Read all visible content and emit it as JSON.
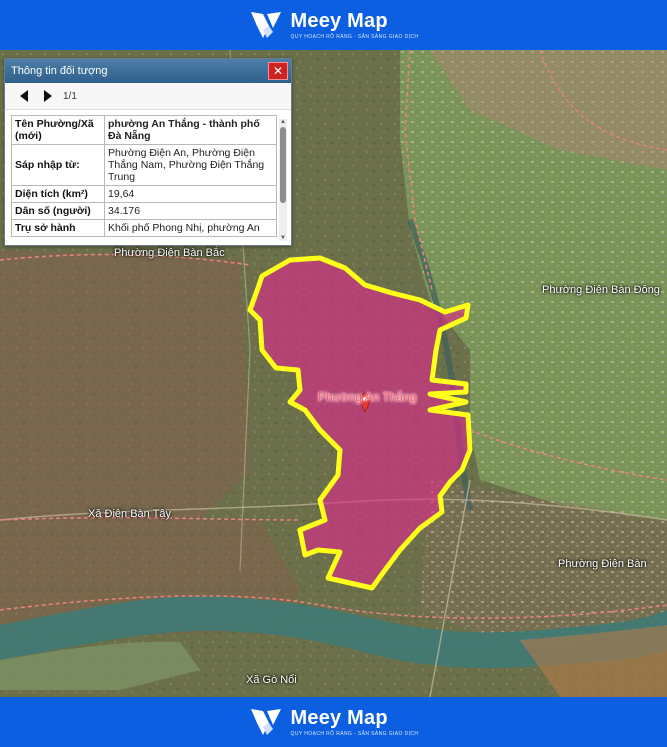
{
  "brand": {
    "name": "Meey Map",
    "tagline": "QUY HOẠCH RÕ RÀNG - SẴN SÀNG GIAO DỊCH"
  },
  "popup": {
    "title": "Thông tin đối tượng",
    "close_icon": "close-icon",
    "pager": "1/1",
    "rows": [
      {
        "key": "Tên Phường/Xã (mới)",
        "value": "phường An Thắng - thành phố Đà Nẵng"
      },
      {
        "key": "Sáp nhập từ:",
        "value": "Phường Điện An, Phường Điện Thắng Nam, Phường Điện Thắng Trung"
      },
      {
        "key": "Diện tích (km²)",
        "value": "19,64"
      },
      {
        "key": "Dân số (người)",
        "value": "34.176"
      },
      {
        "key": "Trụ sở hành",
        "value": "Khối phố Phong Nhị, phường An"
      }
    ]
  },
  "map": {
    "highlight_color": "#e0288a",
    "border_color": "#ffff1a",
    "marker_color": "#e53935",
    "labels": {
      "an_thang": "Phường An Thắng",
      "dien_ban_bac": "Phường Điện Bàn Bắc",
      "dien_ban_dong": "Phường Điện Bàn Đông",
      "dien_ban_tay": "Xã Điện Bàn Tây",
      "dien_ban": "Phường Điện Bàn",
      "go_noi": "Xã Gò Nổi"
    }
  }
}
